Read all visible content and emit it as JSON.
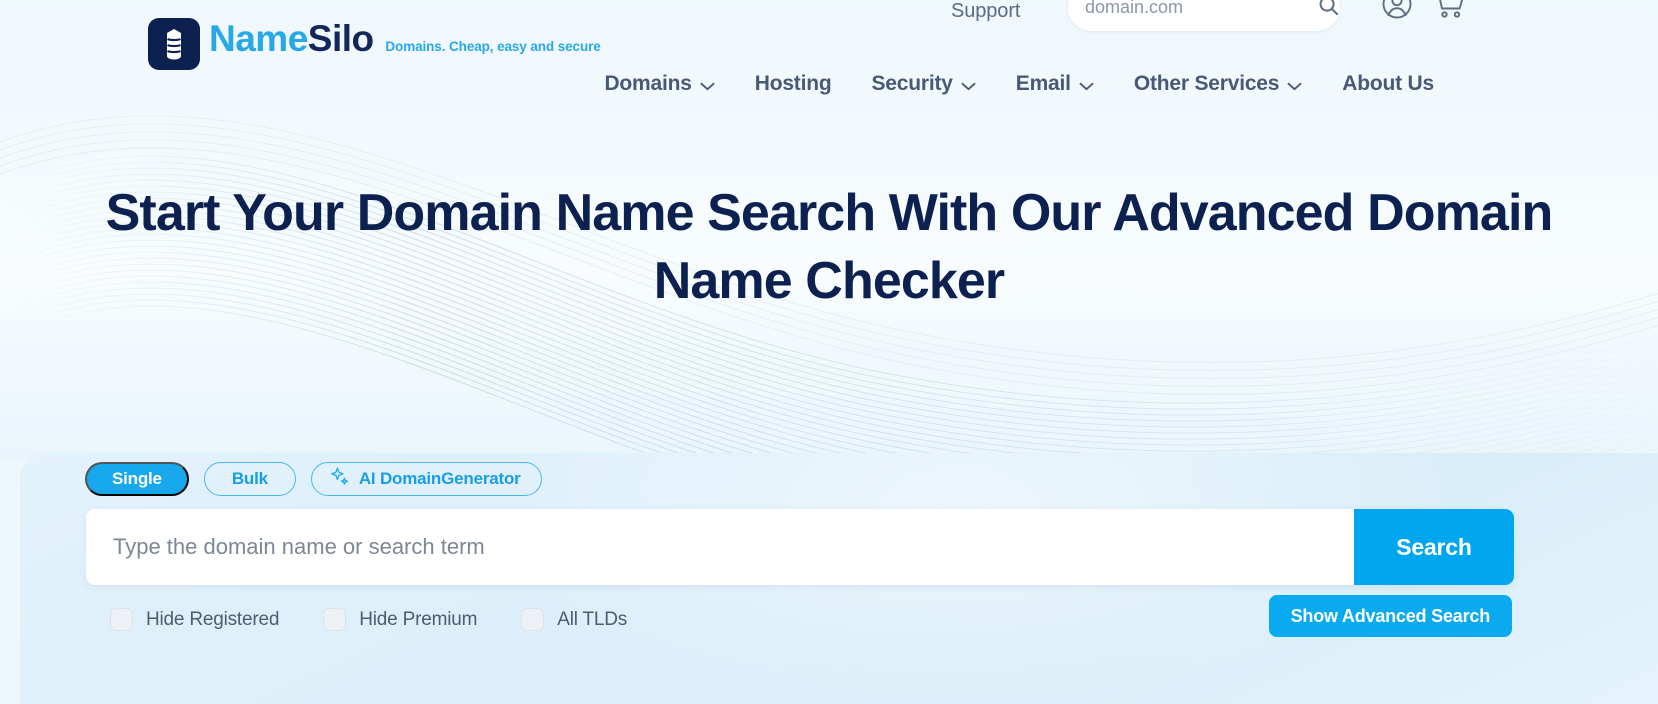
{
  "brand": {
    "name_part1": "Name",
    "name_part2": "Silo",
    "tagline": "Domains. Cheap, easy and secure",
    "logo_icon": "database-stack-icon",
    "colors": {
      "accent": "#29a8e8",
      "navy": "#14275c",
      "button_blue": "#00a7ef"
    }
  },
  "header": {
    "support_label": "Support",
    "search": {
      "placeholder": "domain.com",
      "value": "",
      "icon": "search-icon"
    },
    "account_icon": "user-circle-icon",
    "cart_icon": "shopping-cart-icon",
    "nav": [
      {
        "label": "Domains",
        "has_dropdown": true
      },
      {
        "label": "Hosting",
        "has_dropdown": false
      },
      {
        "label": "Security",
        "has_dropdown": true
      },
      {
        "label": "Email",
        "has_dropdown": true
      },
      {
        "label": "Other Services",
        "has_dropdown": true
      },
      {
        "label": "About Us",
        "has_dropdown": false
      }
    ]
  },
  "hero": {
    "title": "Start Your Domain Name Search With Our Advanced Domain Name Checker"
  },
  "search_panel": {
    "tabs": [
      {
        "label": "Single",
        "active": true,
        "icon": null
      },
      {
        "label": "Bulk",
        "active": false,
        "icon": null
      },
      {
        "label": "AI DomainGenerator",
        "active": false,
        "icon": "sparkle-icon"
      }
    ],
    "input": {
      "placeholder": "Type the domain name or search term",
      "value": ""
    },
    "search_button": "Search",
    "options": [
      {
        "label": "Hide Registered",
        "checked": false
      },
      {
        "label": "Hide Premium",
        "checked": false
      },
      {
        "label": "All TLDs",
        "checked": false
      }
    ],
    "advanced_button": "Show Advanced Search"
  }
}
